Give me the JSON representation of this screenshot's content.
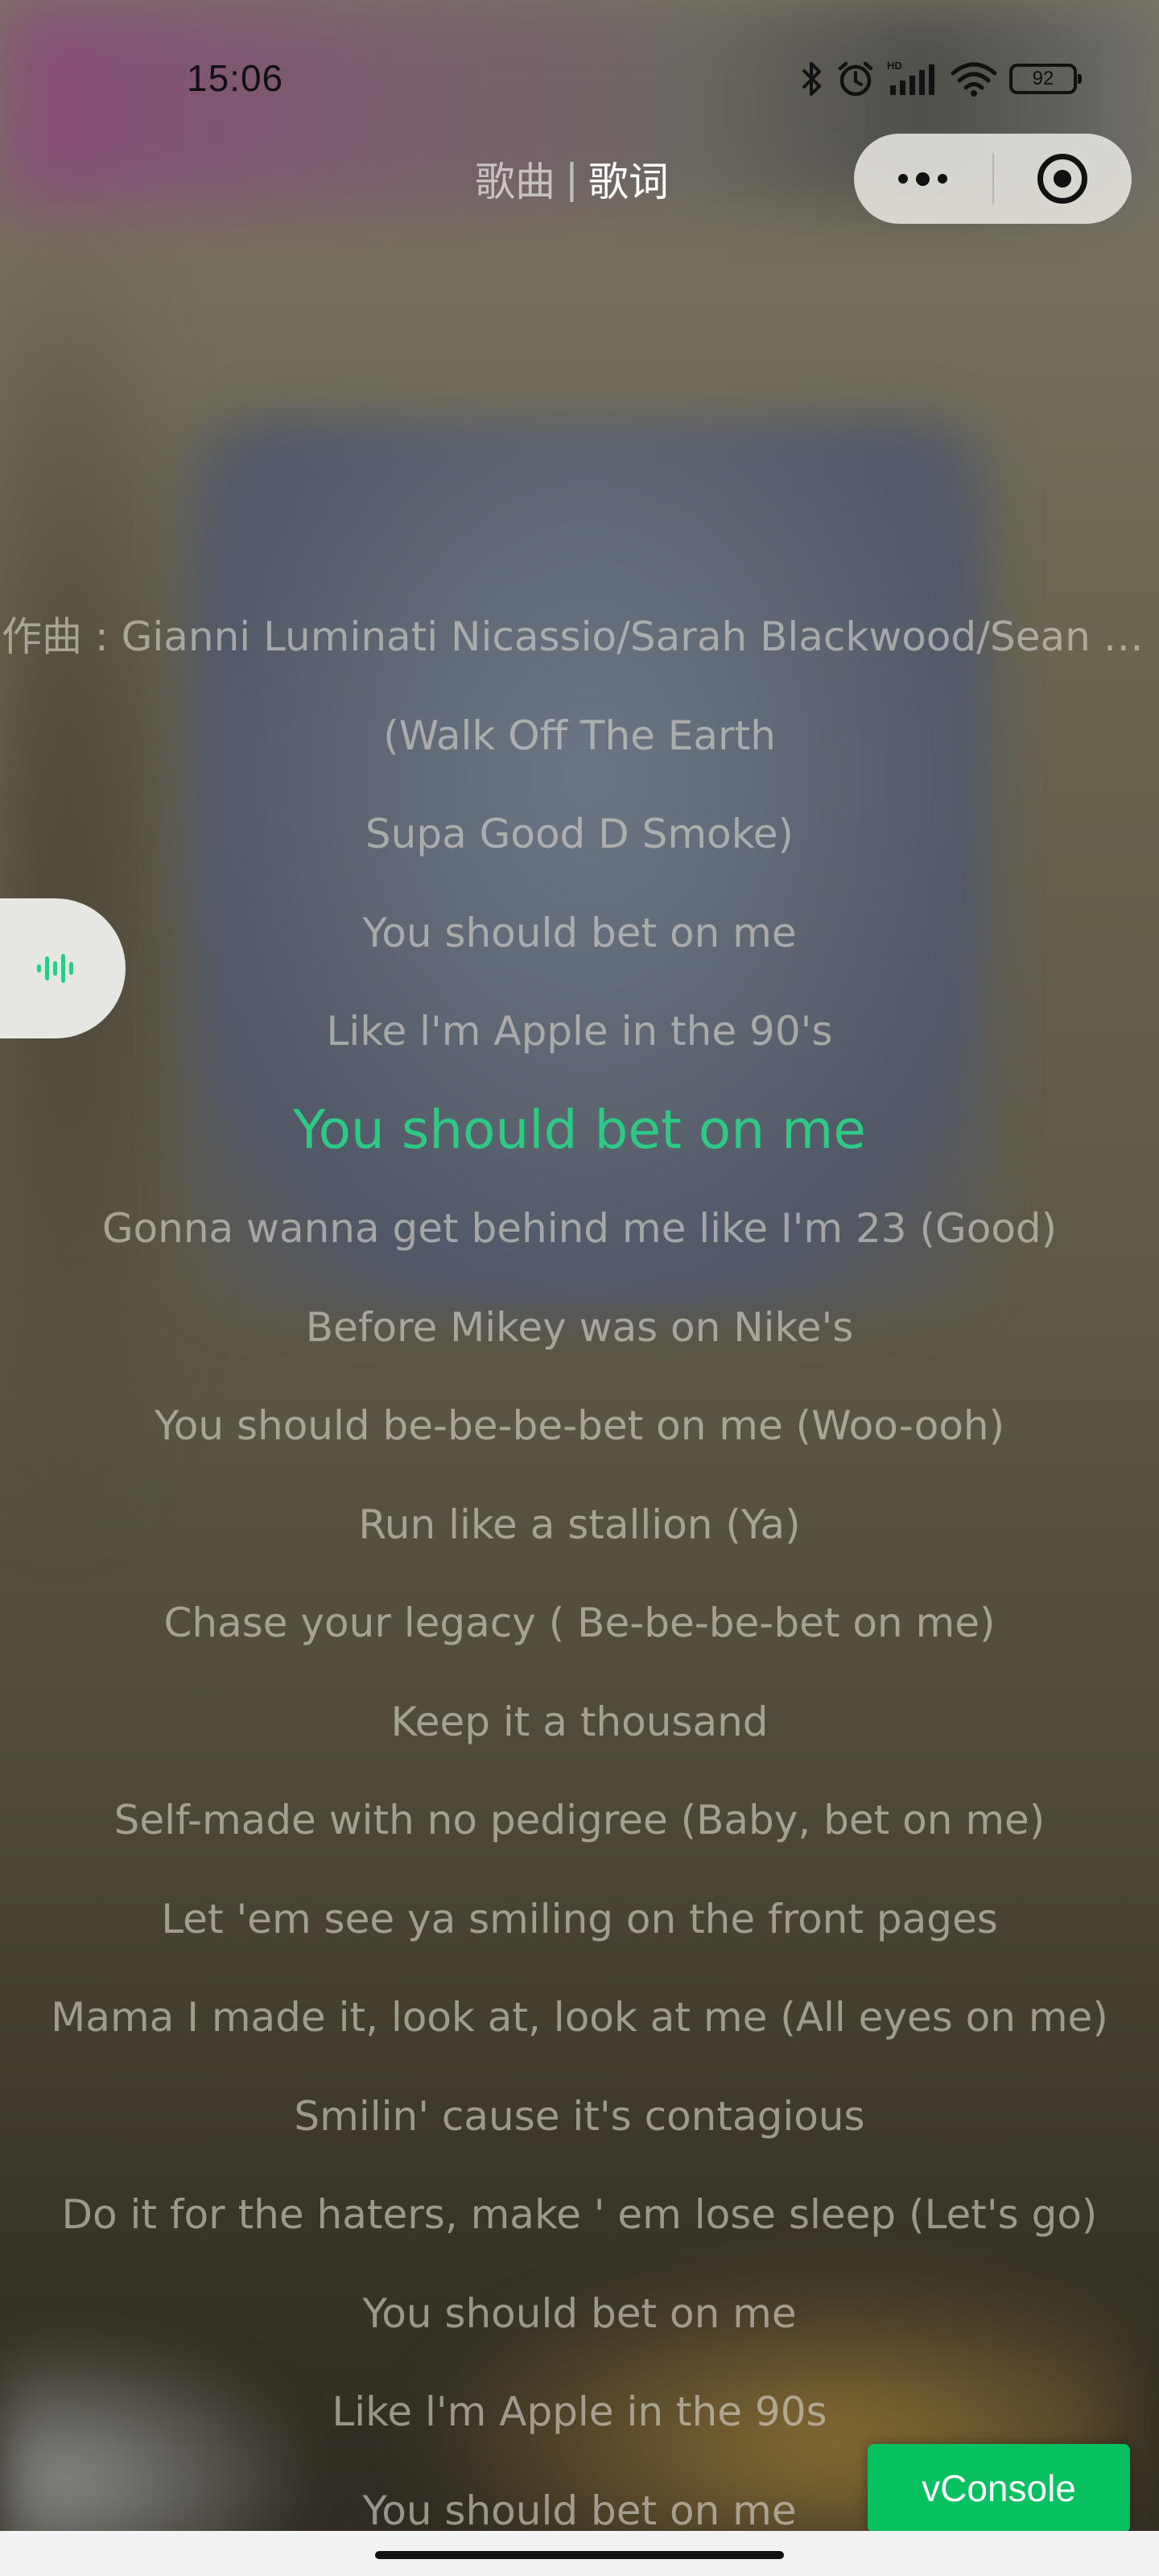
{
  "status_bar": {
    "time": "15:06",
    "battery": "92",
    "icons": [
      "bluetooth-icon",
      "alarm-icon",
      "hd-signal-icon",
      "wifi-icon",
      "battery-icon"
    ]
  },
  "header": {
    "tabs": [
      {
        "label": "歌曲",
        "active": false
      },
      {
        "label": "歌词",
        "active": true
      }
    ],
    "separator": "|"
  },
  "capsule": {
    "icons": [
      "more-dots-icon",
      "close-target-icon"
    ]
  },
  "float_button": {
    "icon": "audio-wave-icon",
    "color": "#2ec985"
  },
  "lyrics": {
    "current_index": 5,
    "highlight_color": "#2ec985",
    "lines": [
      "作曲 : Gianni Luminati Nicassio/Sarah Blackwood/Sean D···",
      "(Walk Off The Earth",
      "Supa Good D Smoke)",
      "You should bet on me",
      "Like l'm Apple in the 90's",
      "You should bet on me",
      "Gonna wanna get behind me like I'm 23 (Good)",
      "Before Mikey was on Nike's",
      "You should be-be-be-bet on me (Woo-ooh)",
      "Run like a stallion (Ya)",
      "Chase your legacy ( Be-be-be-bet on me)",
      "Keep it a thousand",
      "Self-made with no pedigree (Baby, bet on me)",
      "Let 'em see ya smiling on the front pages",
      "Mama I made it, look at, look at me (All eyes on me)",
      "Smilin' cause it's contagious",
      "Do it for the haters, make ' em lose sleep (Let's go)",
      "You should bet on me",
      "Like l'm Apple in the 90s",
      "You should bet on me"
    ]
  },
  "vconsole": {
    "label": "vConsole",
    "color": "#07c160"
  }
}
